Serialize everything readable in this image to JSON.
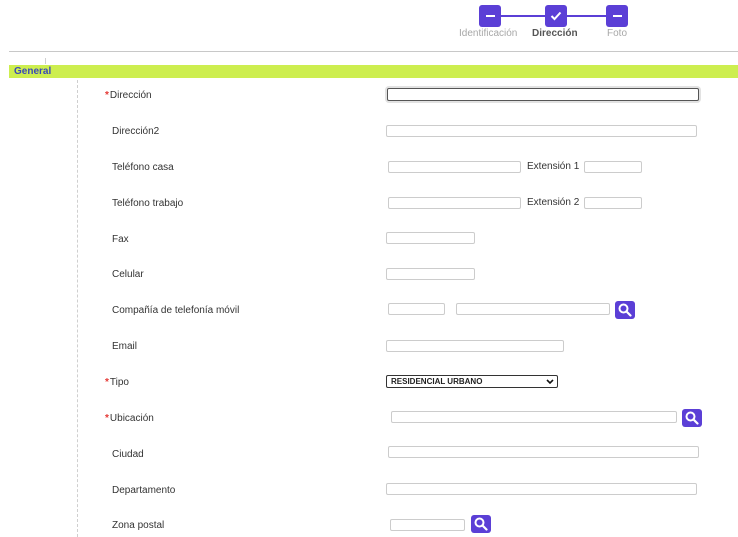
{
  "wizard": {
    "steps": [
      {
        "label": "Identificación",
        "state": "done"
      },
      {
        "label": "Dirección",
        "state": "current"
      },
      {
        "label": "Foto",
        "state": "pending"
      }
    ]
  },
  "section": {
    "title": "General"
  },
  "form": {
    "direccion_label": "Dirección",
    "direccion_value": "",
    "direccion2_label": "Dirección2",
    "direccion2_value": "",
    "telefono_casa_label": "Teléfono casa",
    "telefono_casa_value": "",
    "extension1_label": "Extensión 1",
    "extension1_value": "",
    "telefono_trabajo_label": "Teléfono trabajo",
    "telefono_trabajo_value": "",
    "extension2_label": "Extensión 2",
    "extension2_value": "",
    "fax_label": "Fax",
    "fax_value": "",
    "celular_label": "Celular",
    "celular_value": "",
    "compania_label": "Compañía de telefonía móvil",
    "compania_code_value": "",
    "compania_name_value": "",
    "email_label": "Email",
    "email_value": "",
    "tipo_label": "Tipo",
    "tipo_selected": "RESIDENCIAL URBANO",
    "ubicacion_label": "Ubicación",
    "ubicacion_value": "",
    "ciudad_label": "Ciudad",
    "ciudad_value": "",
    "departamento_label": "Departamento",
    "departamento_value": "",
    "zona_postal_label": "Zona postal",
    "zona_postal_value": "",
    "required_marker": "*"
  },
  "colors": {
    "accent": "#5b3fd6",
    "section_bar": "#cdee4f",
    "section_title": "#3a49b8",
    "required": "#e53935"
  },
  "icons": {
    "step_done": "minus-icon",
    "step_current": "check-icon",
    "step_pending": "minus-icon",
    "lookup": "search-icon",
    "select": "chevron-down-icon"
  }
}
